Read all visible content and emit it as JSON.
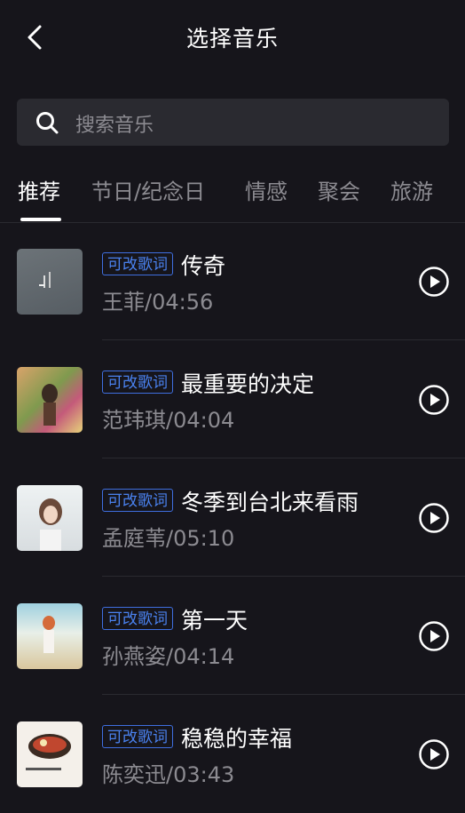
{
  "header": {
    "title": "选择音乐",
    "back_icon": "chevron-left-icon"
  },
  "search": {
    "placeholder": "搜索音乐",
    "icon": "search-icon"
  },
  "tabs": [
    {
      "label": "推荐",
      "active": true
    },
    {
      "label": "节日/纪念日",
      "active": false
    },
    {
      "label": "情感",
      "active": false
    },
    {
      "label": "聚会",
      "active": false
    },
    {
      "label": "旅游",
      "active": false
    }
  ],
  "songs": [
    {
      "badge": "可改歌词",
      "title": "传奇",
      "meta": "王菲/04:56"
    },
    {
      "badge": "可改歌词",
      "title": "最重要的决定",
      "meta": "范玮琪/04:04"
    },
    {
      "badge": "可改歌词",
      "title": "冬季到台北来看雨",
      "meta": "孟庭苇/05:10"
    },
    {
      "badge": "可改歌词",
      "title": "第一天",
      "meta": "孙燕姿/04:14"
    },
    {
      "badge": "可改歌词",
      "title": "稳稳的幸福",
      "meta": "陈奕迅/03:43"
    }
  ],
  "colors": {
    "background": "#16151b",
    "badge": "#4a82f0",
    "secondary_text": "#8c8b91"
  }
}
